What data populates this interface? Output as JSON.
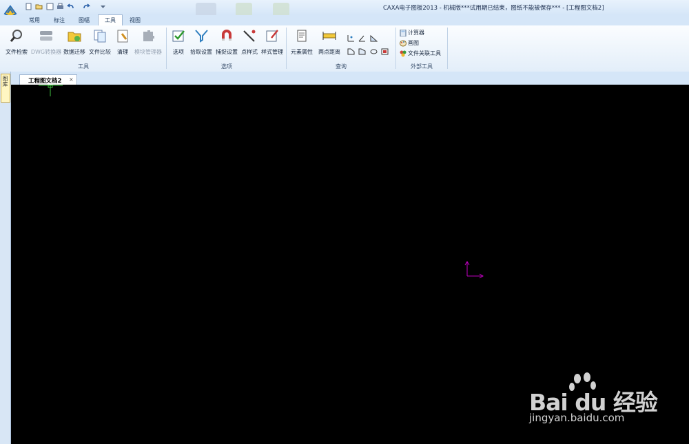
{
  "window": {
    "title": "CAXA电子图板2013 - 机械版***试用期已结束，图纸不能被保存*** - [工程图文档2]"
  },
  "ribbon_tabs": [
    "常用",
    "标注",
    "图幅",
    "工具",
    "视图"
  ],
  "active_tab": "工具",
  "groups": {
    "tools": {
      "label": "工具",
      "buttons": [
        "文件检索",
        "DWG转换器",
        "数据迁移",
        "文件比较",
        "清理",
        "模块管理器"
      ]
    },
    "options": {
      "label": "选项",
      "buttons": [
        "选项",
        "拾取设置",
        "捕捉设置",
        "点样式",
        "样式管理"
      ]
    },
    "query": {
      "label": "查询",
      "buttons": [
        "元素属性",
        "两点距离"
      ]
    },
    "external": {
      "label": "外部工具",
      "items": [
        "计算器",
        "画图",
        "文件关联工具"
      ]
    }
  },
  "document": {
    "tab_label": "工程图文档2",
    "close_symbol": "×"
  },
  "side_panel": {
    "label": "图库"
  },
  "watermark": {
    "brand": "Bai du 经验",
    "url": "jingyan.baidu.com"
  },
  "colors": {
    "canvas_bg": "#000000",
    "crosshair": "#40c040",
    "ucs_axes": "#c000c0",
    "ribbon_bg": "#e3eef9",
    "disabled_text": "#9aa6b6"
  }
}
